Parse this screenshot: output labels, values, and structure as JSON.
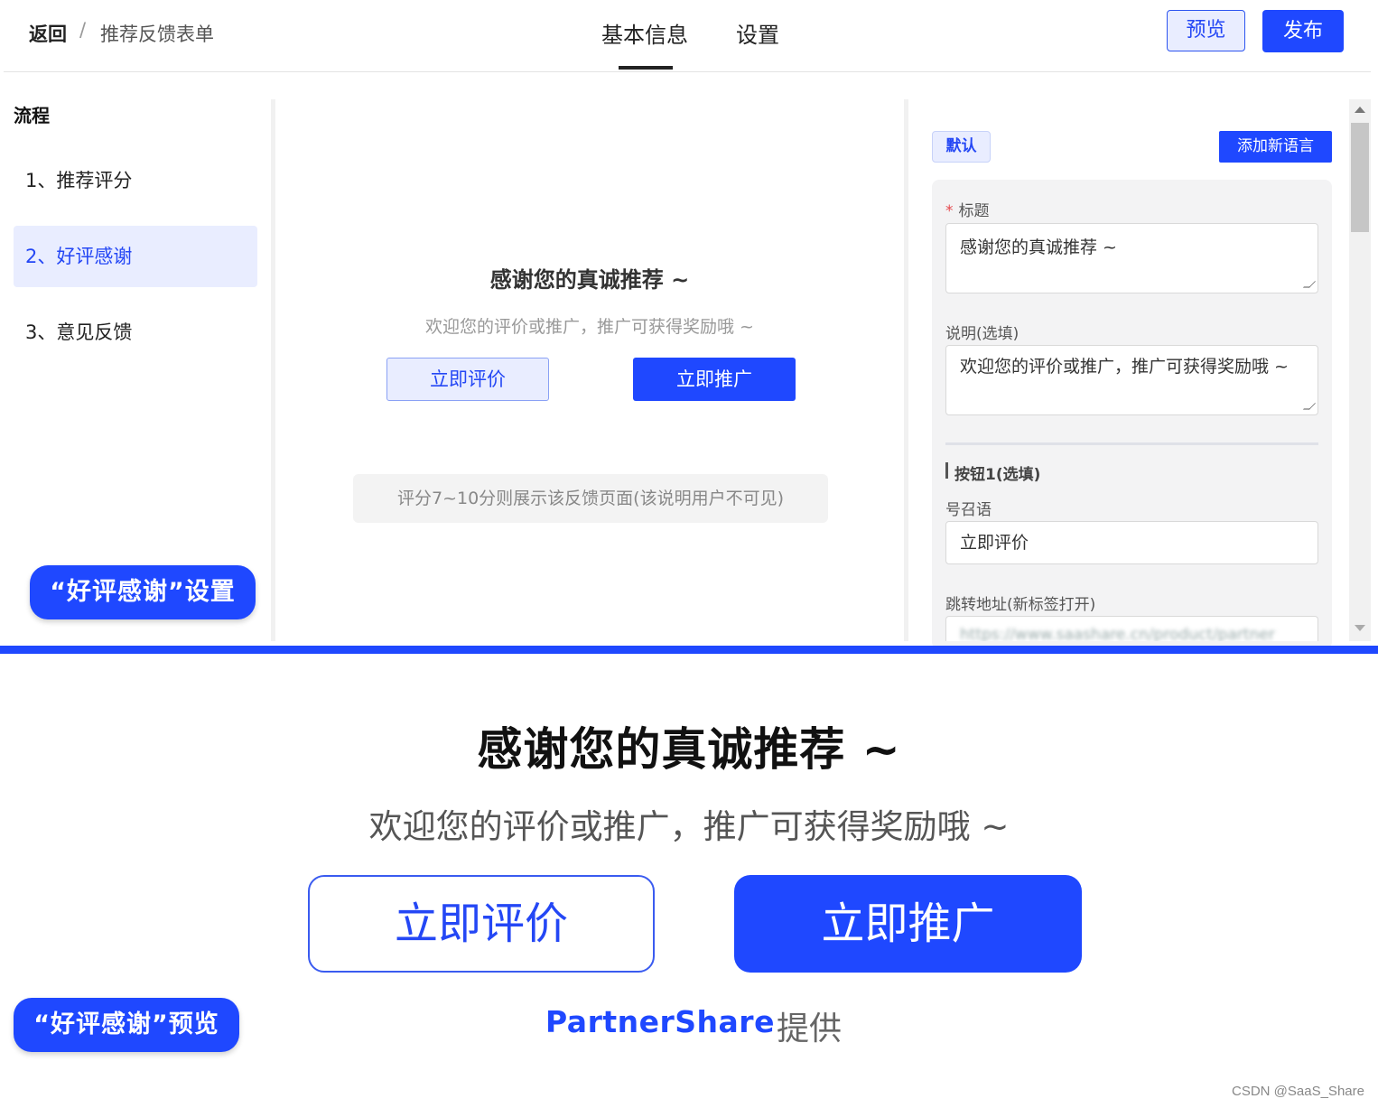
{
  "header": {
    "back_label": "返回",
    "breadcrumb_separator": "/",
    "breadcrumb_current": "推荐反馈表单",
    "tabs": [
      {
        "label": "基本信息",
        "active": true
      },
      {
        "label": "设置",
        "active": false
      }
    ],
    "preview_label": "预览",
    "publish_label": "发布"
  },
  "flow": {
    "title": "流程",
    "items": [
      {
        "label": "1、推荐评分",
        "active": false
      },
      {
        "label": "2、好评感谢",
        "active": true
      },
      {
        "label": "3、意见反馈",
        "active": false
      }
    ]
  },
  "callouts": {
    "settings": "“好评感谢”设置",
    "preview": "“好评感谢”预览"
  },
  "preview": {
    "title": "感谢您的真诚推荐 ~",
    "description": "欢迎您的评价或推广，推广可获得奖励哦 ~",
    "button1": "立即评价",
    "button2": "立即推广",
    "note": "评分7~10分则展示该反馈页面(该说明用户不可见)"
  },
  "config": {
    "default_tag": "默认",
    "add_language": "添加新语言",
    "title_label": "标题",
    "title_value": "感谢您的真诚推荐 ~",
    "desc_label": "说明(选填)",
    "desc_value": "欢迎您的评价或推广，推广可获得奖励哦 ~",
    "section_button1": "按钮1(选填)",
    "cta_label": "号召语",
    "cta_value": "立即评价",
    "url_label": "跳转地址(新标签打开)",
    "url_value": "https://www.saashare.cn/product/partner"
  },
  "big_preview": {
    "title": "感谢您的真诚推荐 ~",
    "description": "欢迎您的评价或推广，推广可获得奖励哦 ~",
    "button1": "立即评价",
    "button2": "立即推广",
    "brand": "PartnerShare",
    "provided_by": "提供"
  },
  "watermark": "CSDN @SaaS_Share",
  "colors": {
    "brand_blue": "#1f48ff",
    "active_bg": "#e9edff",
    "required": "#e5484d"
  }
}
